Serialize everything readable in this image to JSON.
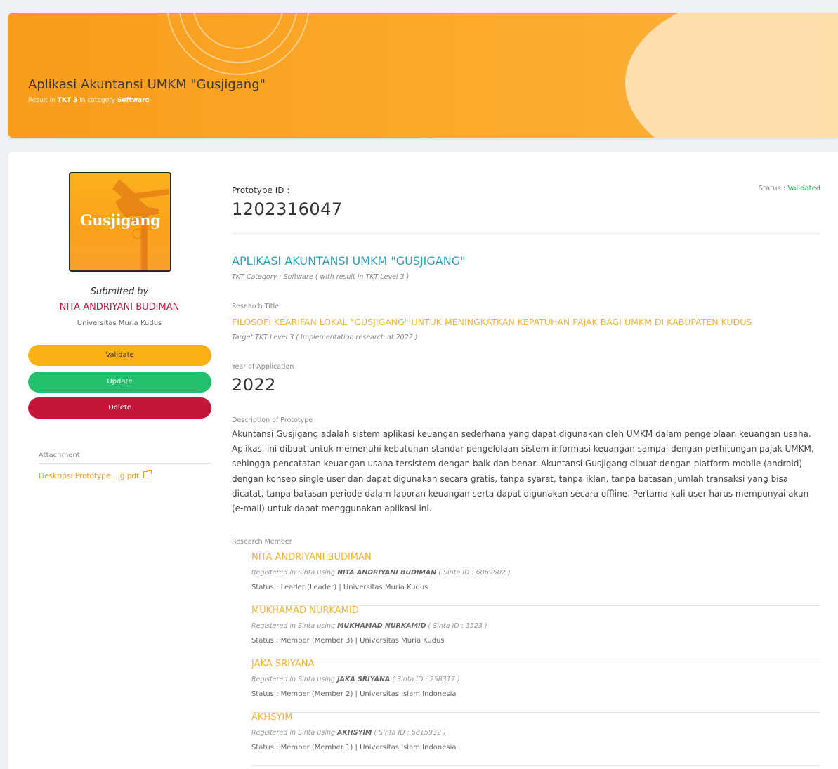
{
  "header": {
    "title": "Aplikasi Akuntansi UMKM \"Gusjigang\"",
    "subtitle_prefix": "Result in ",
    "tkt": "TKT 3",
    "subtitle_mid": " in category ",
    "category": "Software"
  },
  "sidebar": {
    "logo_text": "Gusjigang",
    "submitted_label": "Submited by",
    "submitter_name": "NITA ANDRIYANI BUDIMAN",
    "submitter_institution": "Universitas Muria Kudus",
    "validate_label": "Validate",
    "update_label": "Update",
    "delete_label": "Delete",
    "attachment_label": "Attachment",
    "attachment_file": "Deskripsi Prototype ...g.pdf"
  },
  "main": {
    "prototype_id_label": "Prototype ID :",
    "prototype_id": "1202316047",
    "status_label": "Status : ",
    "status_value": "Validated",
    "title": "APLIKASI AKUNTANSI UMKM \"GUSJIGANG\"",
    "tkt_category": "TKT Category : Software ( with result in TKT Level  3 )",
    "research_title_label": "Research Title",
    "research_title": "FILOSOFI KEARIFAN LOKAL \"GUSJIGANG\" UNTUK MENINGKATKAN KEPATUHAN PAJAK BAGI UMKM DI KABUPATEN KUDUS",
    "target_tkt": "Target TKT Level 3 ( Implementation research at  2022 )",
    "year_label": "Year of Application",
    "year": "2022",
    "description_label": "Description of Prototype",
    "description": "Akuntansi Gusjigang adalah sistem aplikasi keuangan sederhana yang dapat digunakan oleh UMKM dalam pengelolaan keuangan usaha. Aplikasi ini dibuat untuk memenuhi kebutuhan standar pengelolaan sistem informasi keuangan sampai dengan perhitungan pajak UMKM, sehingga pencatatan keuangan usaha tersistem dengan baik dan benar. Akuntansi Gusjigang dibuat dengan platform mobile (android) dengan konsep single user dan dapat digunakan secara gratis, tanpa syarat, tanpa iklan, tanpa batasan jumlah transaksi yang bisa dicatat, tanpa batasan periode dalam laporan keuangan serta dapat digunakan secara offline. Pertama kali user harus mempunyai akun (e-mail) untuk dapat menggunakan aplikasi ini.",
    "research_member_label": "Research Member",
    "members": [
      {
        "name": "NITA ANDRIYANI BUDIMAN",
        "reg_prefix": "Registered in Sinta using ",
        "reg_name": "NITA ANDRIYANI BUDIMAN",
        "reg_suffix": " ( Sinta ID : 6069502 )",
        "status": "Status : Leader (Leader)   |  Universitas Muria Kudus"
      },
      {
        "name": "MUKHAMAD NURKAMID",
        "reg_prefix": "Registered in Sinta using ",
        "reg_name": "MUKHAMAD NURKAMID",
        "reg_suffix": " ( Sinta ID : 3523 )",
        "status": "Status : Member (Member 3)   |  Universitas Muria Kudus"
      },
      {
        "name": "JAKA SRIYANA",
        "reg_prefix": "Registered in Sinta using ",
        "reg_name": "JAKA SRIYANA",
        "reg_suffix": " ( Sinta ID : 258317 )",
        "status": "Status : Member (Member 2)   |  Universitas Islam Indonesia"
      },
      {
        "name": "AKHSYIM",
        "reg_prefix": "Registered in Sinta using ",
        "reg_name": "AKHSYIM",
        "reg_suffix": " ( Sinta ID : 6815932 )",
        "status": "Status : Member (Member 1)   |  Universitas Islam Indonesia"
      }
    ]
  },
  "colors": {
    "accent_orange": "#f8b132",
    "title_teal": "#2d9fbf",
    "status_green": "#2bb55b",
    "delete_red": "#c41638",
    "update_green": "#22c06c",
    "validate_yellow": "#fbb115"
  }
}
